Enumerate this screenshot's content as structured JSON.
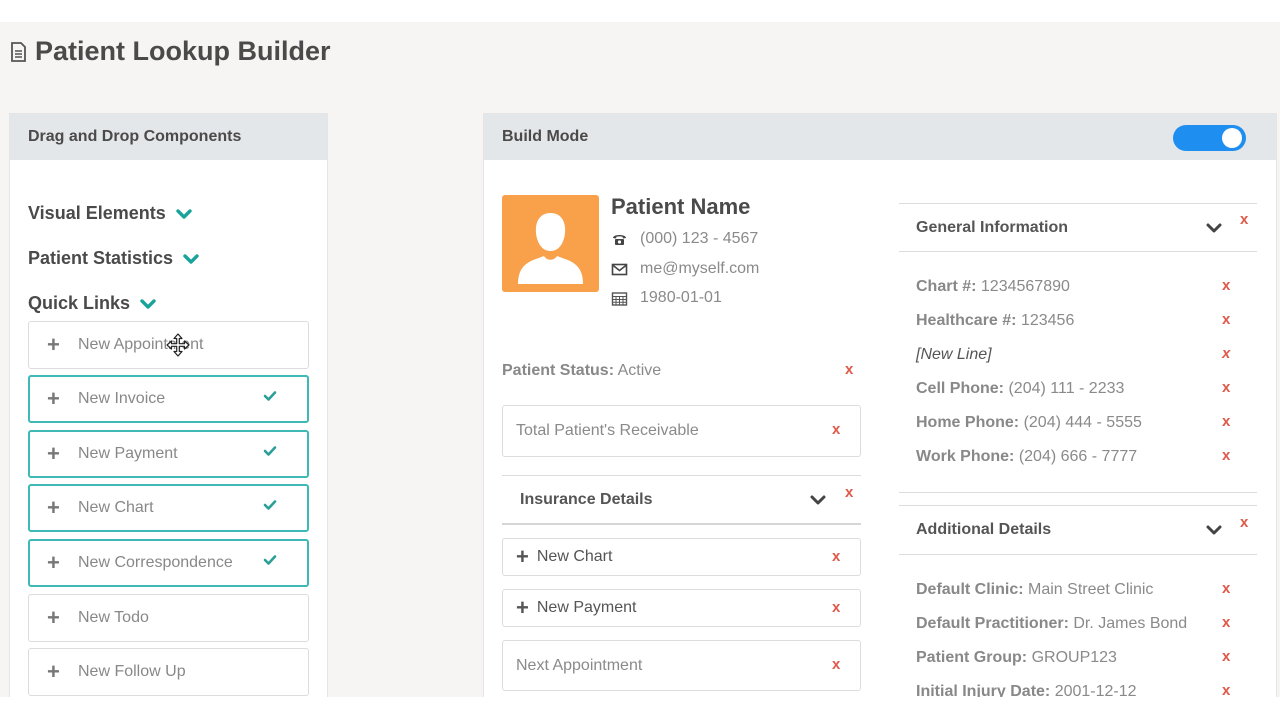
{
  "page": {
    "title": "Patient Lookup Builder",
    "title_icon": "document-icon"
  },
  "left_panel": {
    "header": "Drag and Drop Components",
    "sections": [
      {
        "label": "Visual Elements",
        "icon": "chevron-down-icon"
      },
      {
        "label": "Patient Statistics",
        "icon": "chevron-down-icon"
      },
      {
        "label": "Quick Links",
        "icon": "chevron-down-icon"
      }
    ],
    "quick_links": [
      {
        "label": "New Appointment",
        "selected": false
      },
      {
        "label": "New Invoice",
        "selected": true
      },
      {
        "label": "New Payment",
        "selected": true
      },
      {
        "label": "New Chart",
        "selected": true
      },
      {
        "label": "New Correspondence",
        "selected": true
      },
      {
        "label": "New Todo",
        "selected": false
      },
      {
        "label": "New Follow Up",
        "selected": false
      }
    ]
  },
  "build_panel": {
    "header": "Build Mode",
    "build_mode_on": true,
    "patient": {
      "name": "Patient Name",
      "phone": "(000) 123 - 4567",
      "email": "me@myself.com",
      "dob": "1980-01-01"
    },
    "status": {
      "label": "Patient Status:",
      "value": "Active"
    },
    "receivable": "Total Patient's Receivable",
    "insurance_header": "Insurance Details",
    "left_buttons": [
      {
        "label": "New Chart"
      },
      {
        "label": "New Payment"
      }
    ],
    "next_appointment": "Next Appointment",
    "general_info": {
      "header": "General Information",
      "fields": [
        {
          "label": "Chart #:",
          "value": "1234567890"
        },
        {
          "label": "Healthcare #:",
          "value": "123456"
        },
        {
          "label": "[New Line]",
          "value": ""
        },
        {
          "label": "Cell Phone:",
          "value": "(204) 111 - 2233"
        },
        {
          "label": "Home Phone:",
          "value": "(204) 444 - 5555"
        },
        {
          "label": "Work Phone:",
          "value": "(204) 666 - 7777"
        }
      ]
    },
    "additional_details": {
      "header": "Additional Details",
      "fields": [
        {
          "label": "Default Clinic:",
          "value": "Main Street Clinic"
        },
        {
          "label": "Default Practitioner:",
          "value": "Dr. James Bond"
        },
        {
          "label": "Patient Group:",
          "value": "GROUP123"
        },
        {
          "label": "Initial Injury Date:",
          "value": "2001-12-12"
        }
      ]
    },
    "remove_symbol": "x"
  },
  "colors": {
    "accent_teal": "#1aa39a",
    "toggle_blue": "#1e8ff0",
    "avatar_orange": "#f8a04a",
    "remove_red": "#e05a4a"
  }
}
